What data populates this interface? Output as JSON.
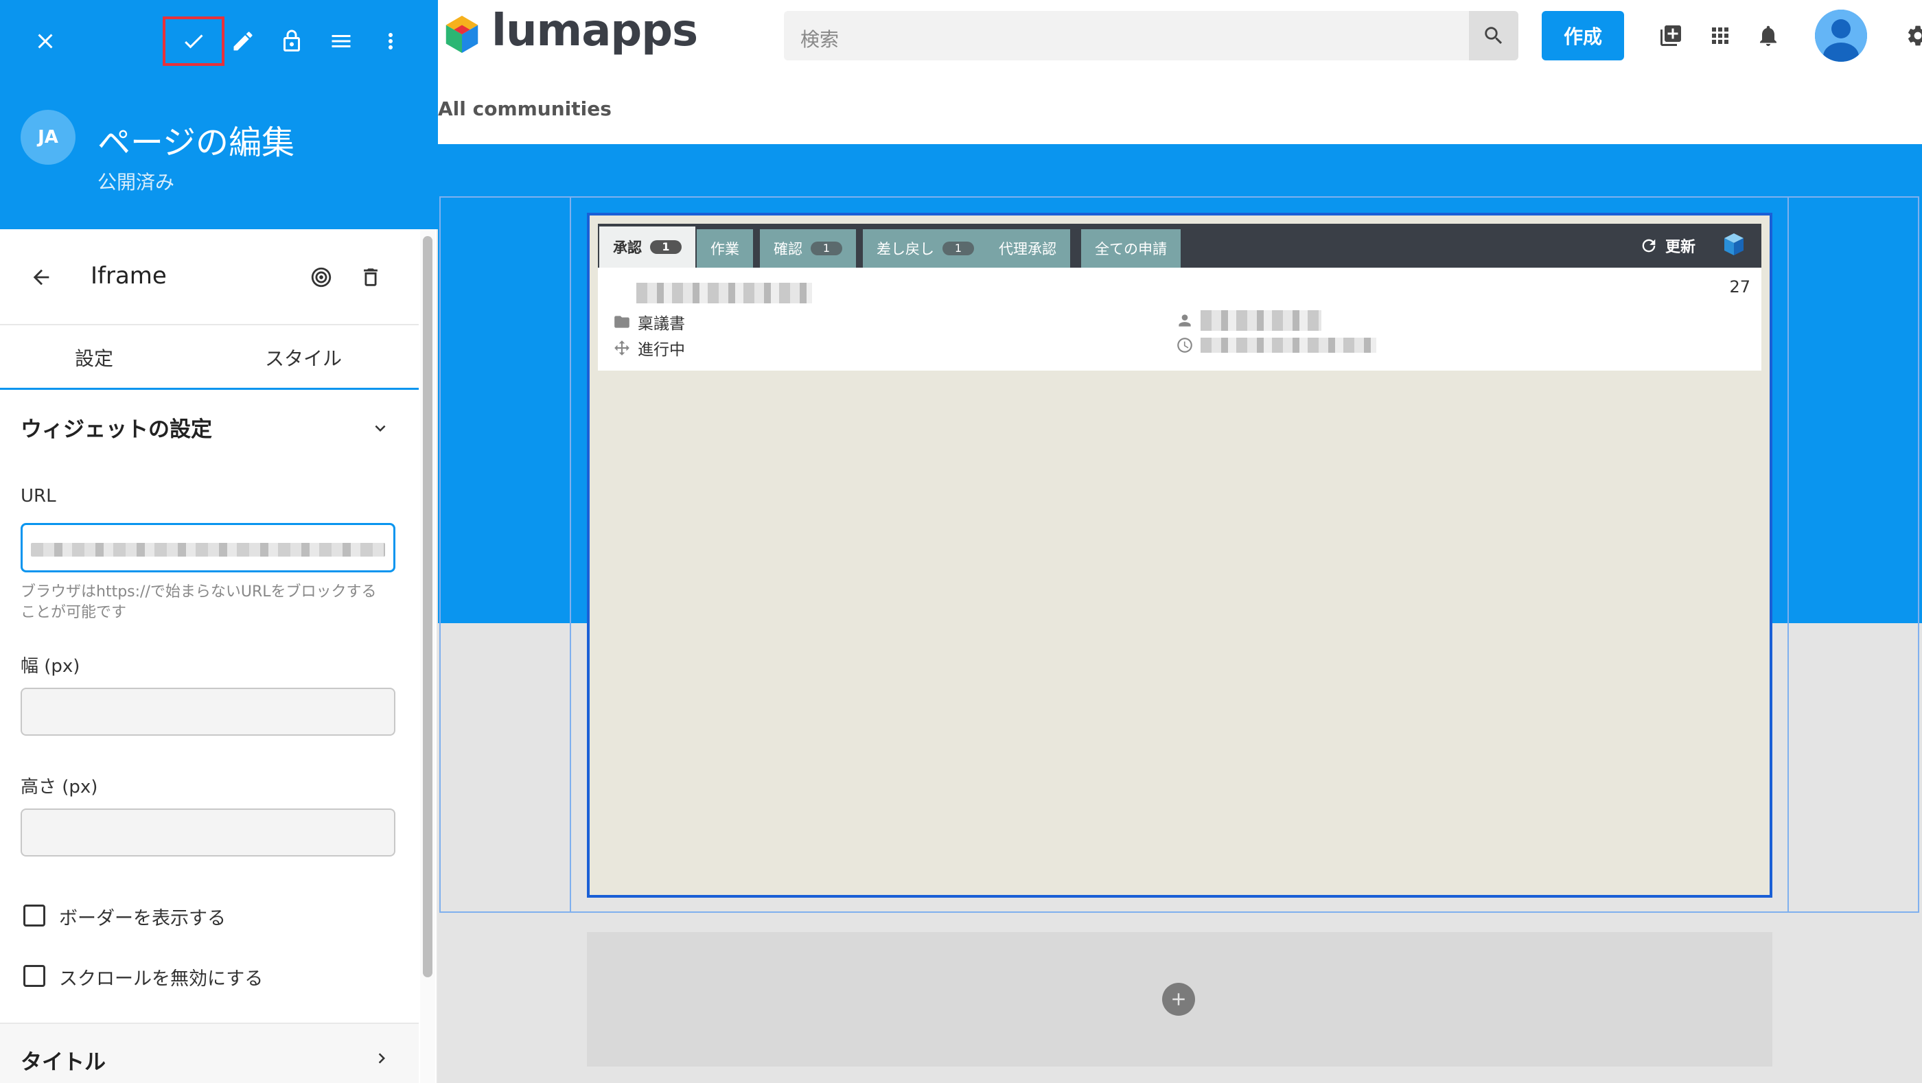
{
  "editor": {
    "initials": "JA",
    "title": "ページの編集",
    "status": "公開済み"
  },
  "widget": {
    "name": "Iframe"
  },
  "tabs": {
    "settings": "設定",
    "style": "スタイル"
  },
  "settings": {
    "section_title": "ウィジェットの設定",
    "url_label": "URL",
    "url_hint": "ブラウザはhttps://で始まらないURLをブロックすることが可能です",
    "width_label": "幅 (px)",
    "width_value": "",
    "height_label": "高さ (px)",
    "height_value": "",
    "show_border_label": "ボーダーを表示する",
    "show_border_checked": false,
    "disable_scroll_label": "スクロールを無効にする",
    "disable_scroll_checked": false,
    "title_section": "タイトル"
  },
  "topbar": {
    "brand": "lumapps",
    "search_placeholder": "検索",
    "create_label": "作成",
    "breadcrumb": "All communities"
  },
  "iframe_content": {
    "tabs": [
      {
        "label": "承認",
        "badge": "1",
        "active": true
      },
      {
        "label": "作業",
        "badge": "",
        "active": false
      },
      {
        "label": "確認",
        "badge": "1",
        "active": false
      },
      {
        "label": "差し戻し",
        "badge": "1",
        "active": false
      },
      {
        "label": "代理承認",
        "badge": "",
        "active": false
      },
      {
        "label": "全ての申請",
        "badge": "",
        "active": false
      }
    ],
    "refresh_label": "更新",
    "item_number": "27",
    "item_category": "稟議書",
    "item_status": "進行中"
  },
  "colors": {
    "primary": "#0a95ef",
    "highlight_border": "#e8313a",
    "iframe_tabbar": "#3a3f47",
    "iframe_tab": "#7aa4a6",
    "iframe_bg": "#e9e7dc"
  },
  "icons": [
    "close-icon",
    "check-icon",
    "pencil-icon",
    "lock-icon",
    "menu-icon",
    "more-vert-icon",
    "arrow-back-icon",
    "target-icon",
    "trash-icon",
    "chevron-down-icon",
    "chevron-right-icon",
    "search-icon",
    "book-icon",
    "apps-icon",
    "bell-icon",
    "user-icon",
    "gear-icon",
    "refresh-icon",
    "add-icon"
  ]
}
